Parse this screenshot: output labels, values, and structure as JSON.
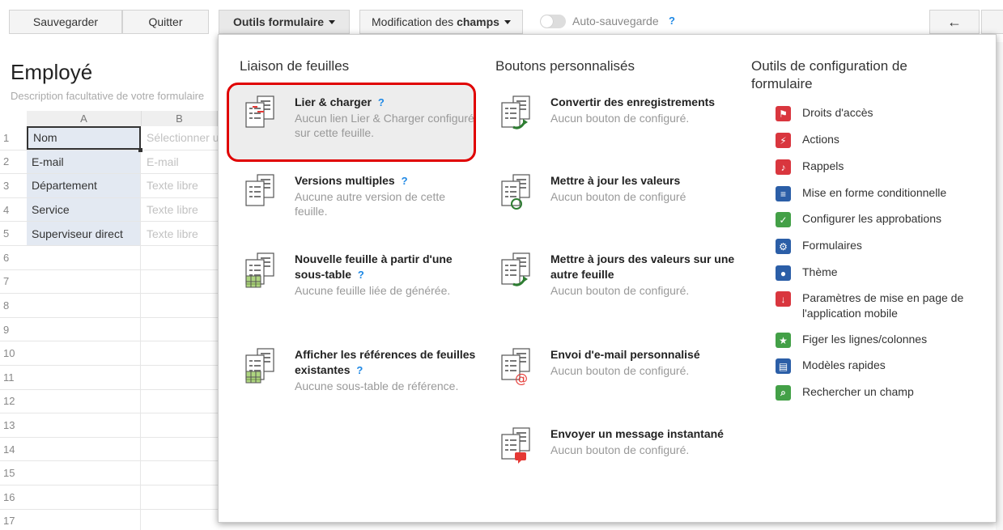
{
  "toolbar": {
    "save": "Sauvegarder",
    "quit": "Quitter",
    "form_tools": "Outils formulaire",
    "field_edit_prefix": "Modification des ",
    "field_edit_bold": "champs",
    "autosave": "Auto-sauvegarde",
    "help": "?",
    "back_icon": "arrow-left-icon",
    "back_glyph": "←"
  },
  "sheet": {
    "title": "Employé",
    "description": "Description facultative de votre formulaire",
    "columns": [
      "A",
      "B"
    ],
    "rows": [
      {
        "num": "1",
        "a": "Nom",
        "b": "Sélectionner u"
      },
      {
        "num": "2",
        "a": "E-mail",
        "b": "E-mail"
      },
      {
        "num": "3",
        "a": "Département",
        "b": "Texte libre"
      },
      {
        "num": "4",
        "a": "Service",
        "b": "Texte libre"
      },
      {
        "num": "5",
        "a": "Superviseur direct",
        "b": "Texte libre"
      },
      {
        "num": "6",
        "a": "",
        "b": ""
      },
      {
        "num": "7",
        "a": "",
        "b": ""
      },
      {
        "num": "8",
        "a": "",
        "b": ""
      },
      {
        "num": "9",
        "a": "",
        "b": ""
      },
      {
        "num": "10",
        "a": "",
        "b": ""
      },
      {
        "num": "11",
        "a": "",
        "b": ""
      },
      {
        "num": "12",
        "a": "",
        "b": ""
      },
      {
        "num": "13",
        "a": "",
        "b": ""
      },
      {
        "num": "14",
        "a": "",
        "b": ""
      },
      {
        "num": "15",
        "a": "",
        "b": ""
      },
      {
        "num": "16",
        "a": "",
        "b": ""
      },
      {
        "num": "17",
        "a": "",
        "b": ""
      }
    ]
  },
  "menu": {
    "linking": {
      "title": "Liaison de feuilles",
      "items": [
        {
          "title": "Lier & charger",
          "help": "?",
          "sub": "Aucun lien Lier & Charger configuré sur cette feuille.",
          "icon": "link-load-icon"
        },
        {
          "title": "Versions multiples",
          "help": "?",
          "sub": "Aucune autre version de cette feuille.",
          "icon": "multiple-versions-icon"
        },
        {
          "title": "Nouvelle feuille à partir d'une sous-table",
          "help": "?",
          "sub": "Aucune feuille liée de générée.",
          "icon": "new-sheet-from-subtable-icon"
        },
        {
          "title": "Afficher les références de feuilles existantes",
          "help": "?",
          "sub": "Aucune sous-table de référence.",
          "icon": "sheet-references-icon"
        }
      ]
    },
    "buttons": {
      "title": "Boutons personnalisés",
      "items": [
        {
          "title": "Convertir des enregistrements",
          "sub": "Aucun bouton de configuré.",
          "icon": "convert-records-icon"
        },
        {
          "title": "Mettre à jour les valeurs",
          "sub": "Aucun bouton de configuré",
          "icon": "update-values-icon"
        },
        {
          "title": "Mettre à jours des valeurs sur une autre feuille",
          "sub": "Aucun bouton de configuré.",
          "icon": "update-other-sheet-icon"
        },
        {
          "title": "Envoi d'e-mail personnalisé",
          "sub": "Aucun bouton de configuré.",
          "icon": "custom-email-icon"
        },
        {
          "title": "Envoyer un message instantané",
          "sub": "Aucun bouton de configuré.",
          "icon": "instant-message-icon"
        }
      ]
    },
    "config": {
      "title": "Outils de configuration de formulaire",
      "items": [
        {
          "label": "Droits d'accès",
          "icon": "access-rights-icon",
          "color": "#d9363e"
        },
        {
          "label": "Actions",
          "icon": "lightning-icon",
          "color": "#d9363e"
        },
        {
          "label": "Rappels",
          "icon": "bell-icon",
          "color": "#d9363e"
        },
        {
          "label": "Mise en forme conditionnelle",
          "icon": "conditional-format-icon",
          "color": "#2b5ea7"
        },
        {
          "label": "Configurer les approbations",
          "icon": "approval-icon",
          "color": "#43a047"
        },
        {
          "label": "Formulaires",
          "icon": "gear-icon",
          "color": "#2b5ea7"
        },
        {
          "label": "Thème",
          "icon": "palette-icon",
          "color": "#2b5ea7"
        },
        {
          "label": "Paramètres de mise en page de l'application mobile",
          "icon": "mobile-layout-icon",
          "color": "#d9363e"
        },
        {
          "label": "Figer les lignes/colonnes",
          "icon": "pin-icon",
          "color": "#43a047"
        },
        {
          "label": "Modèles rapides",
          "icon": "template-icon",
          "color": "#2b5ea7"
        },
        {
          "label": "Rechercher un champ",
          "icon": "search-field-icon",
          "color": "#43a047"
        }
      ]
    }
  }
}
